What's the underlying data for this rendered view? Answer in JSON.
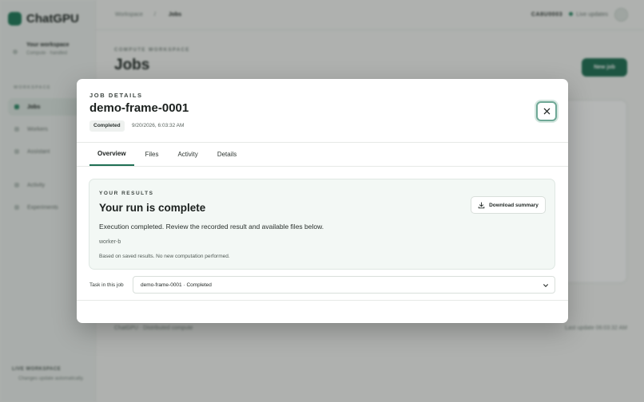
{
  "sidebar": {
    "logo": "ChatGPU",
    "workspace_title": "Your workspace",
    "workspace_sub": "Compute · handled",
    "section": "WORKSPACE",
    "items": [
      {
        "label": "Jobs"
      },
      {
        "label": "Workers"
      },
      {
        "label": "Assistant"
      },
      {
        "label": "Activity"
      },
      {
        "label": "Experiments"
      }
    ],
    "footer_title": "LIVE WORKSPACE",
    "footer_sub": "Changes update automatically."
  },
  "topbar": {
    "crumb_root": "Workspace",
    "crumb_sep": "/",
    "crumb_current": "Jobs",
    "clock": "CA8U0003",
    "live": "Live updates"
  },
  "page": {
    "eyebrow": "COMPUTE WORKSPACE",
    "title": "Jobs",
    "new_job": "New job",
    "footer_left": "ChatGPU · Distributed compute",
    "footer_right": "Last update 06:03:32 AM"
  },
  "modal": {
    "eyebrow": "JOB DETAILS",
    "title": "demo-frame-0001",
    "status": "Completed",
    "date": "9/20/2026, 6:03:32 AM",
    "tabs": [
      {
        "label": "Overview"
      },
      {
        "label": "Files"
      },
      {
        "label": "Activity"
      },
      {
        "label": "Details"
      }
    ],
    "result": {
      "eyebrow": "YOUR RESULTS",
      "title": "Your run is complete",
      "description": "Execution completed. Review the recorded result and available files below.",
      "worker": "worker-b",
      "note": "Based on saved results. No new computation performed.",
      "download": "Download summary"
    },
    "task_label": "Task in this job",
    "task_value": "demo-frame-0001 · Completed"
  },
  "colors": {
    "accent": "#1f6f54",
    "close_ring": "#6fa896"
  }
}
